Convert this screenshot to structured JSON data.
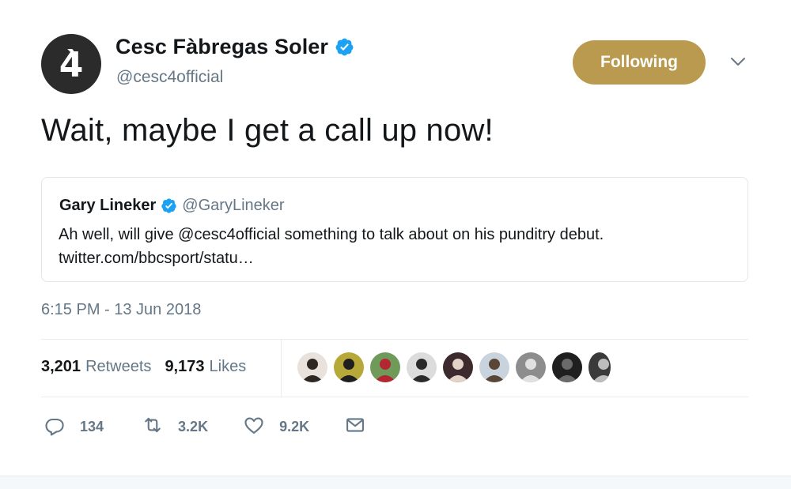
{
  "author": {
    "avatar_glyph": "4̀",
    "display_name": "Cesc Fàbregas Soler",
    "handle": "@cesc4official",
    "verified": true
  },
  "follow_button": {
    "label": "Following",
    "color": "#b99a4e"
  },
  "tweet": {
    "text": "Wait, maybe I get a call up now!",
    "timestamp": "6:15 PM - 13 Jun 2018"
  },
  "quoted_tweet": {
    "display_name": "Gary Lineker",
    "handle": "@GaryLineker",
    "verified": true,
    "text": "Ah well, will give @cesc4official something to talk about on his punditry debut. twitter.com/bbcsport/statu…"
  },
  "stats": {
    "retweets_count": "3,201",
    "retweets_label": "Retweets",
    "likes_count": "9,173",
    "likes_label": "Likes"
  },
  "likers": [
    {
      "name": "liker-1",
      "bg": "#e9e2dc",
      "fg": "#2d2622"
    },
    {
      "name": "liker-2",
      "bg": "#b7a83a",
      "fg": "#1f1f1f"
    },
    {
      "name": "liker-3",
      "bg": "#6f9a5a",
      "fg": "#b32632"
    },
    {
      "name": "liker-4",
      "bg": "#dcdcdc",
      "fg": "#2a2a2a"
    },
    {
      "name": "liker-5",
      "bg": "#3c2a2f",
      "fg": "#e3d2c8"
    },
    {
      "name": "liker-6",
      "bg": "#c9d3dd",
      "fg": "#5a4636"
    },
    {
      "name": "liker-7",
      "bg": "#8d8d8d",
      "fg": "#e0e0e0"
    },
    {
      "name": "liker-8",
      "bg": "#1f1f1f",
      "fg": "#6a6a6a"
    },
    {
      "name": "liker-9",
      "bg": "#3a3a3a",
      "fg": "#bdbdbd"
    }
  ],
  "actions": {
    "reply_count": "134",
    "retweet_count": "3.2K",
    "like_count": "9.2K"
  },
  "colors": {
    "text_primary": "#14171a",
    "text_secondary": "#657786",
    "verified_blue": "#1da1f2",
    "border": "#e1e8ed"
  }
}
